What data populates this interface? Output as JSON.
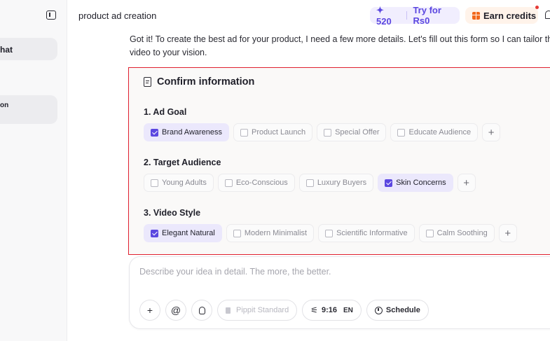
{
  "sidebar": {
    "toggle_icon": "sidebar-toggle-icon",
    "items": [
      {
        "label": "hat"
      },
      {
        "label": "on"
      }
    ]
  },
  "header": {
    "title": "product ad creation",
    "credits": "✦ 520",
    "try_label": "Try for Rs0",
    "earn_label": "Earn credits",
    "accent": "#5b47e0",
    "earn_accent": "#f2681c"
  },
  "message": {
    "text": "Got it! To create the best ad for your product, I need a few more details. Let's fill out this form so I can tailor the video to your vision."
  },
  "form": {
    "title": "Confirm information",
    "border_color": "#e0202f",
    "sections": [
      {
        "title": "1. Ad Goal",
        "options": [
          {
            "label": "Brand Awareness",
            "selected": true
          },
          {
            "label": "Product Launch",
            "selected": false
          },
          {
            "label": "Special Offer",
            "selected": false
          },
          {
            "label": "Educate Audience",
            "selected": false
          }
        ]
      },
      {
        "title": "2. Target Audience",
        "options": [
          {
            "label": "Young Adults",
            "selected": false
          },
          {
            "label": "Eco-Conscious",
            "selected": false
          },
          {
            "label": "Luxury Buyers",
            "selected": false
          },
          {
            "label": "Skin Concerns",
            "selected": true
          }
        ]
      },
      {
        "title": "3. Video Style",
        "options": [
          {
            "label": "Elegant Natural",
            "selected": true
          },
          {
            "label": "Modern Minimalist",
            "selected": false
          },
          {
            "label": "Scientific Informative",
            "selected": false
          },
          {
            "label": "Calm Soothing",
            "selected": false
          }
        ]
      }
    ],
    "add_symbol": "+"
  },
  "composer": {
    "placeholder": "Describe your idea in detail. The more, the better.",
    "add_symbol": "+",
    "mention_symbol": "@",
    "model_label": "Pippit Standard",
    "ratio_label": "9:16",
    "lang_label": "EN",
    "schedule_label": "Schedule"
  }
}
